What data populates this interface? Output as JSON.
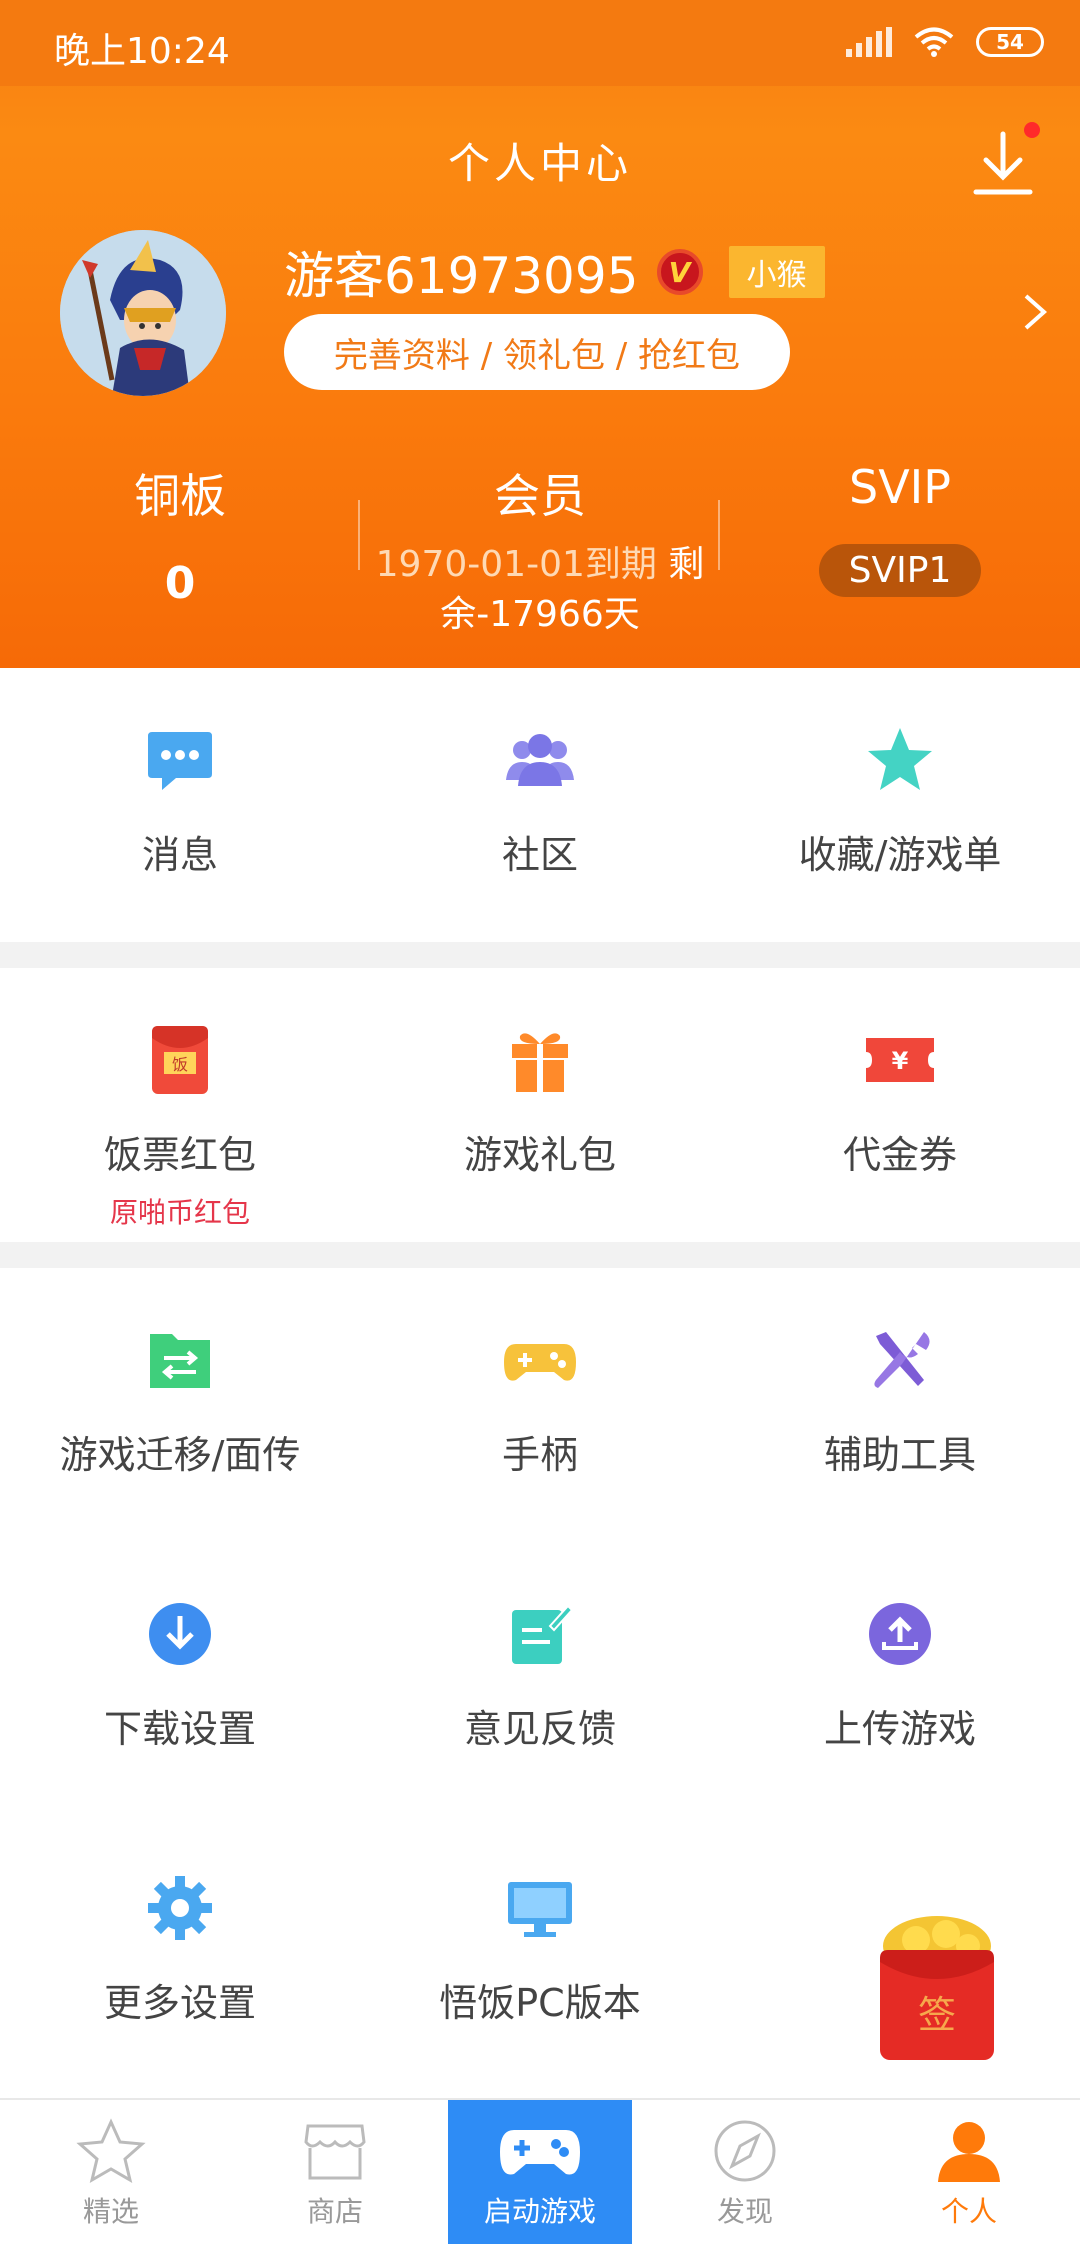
{
  "status_bar": {
    "time": "晚上10:24",
    "battery": "54"
  },
  "header": {
    "title": "个人中心",
    "username": "游客61973095",
    "vip_mark": "V",
    "level_badge": "小猴",
    "profile_button": "完善资料 / 领礼包 / 抢红包"
  },
  "stats": {
    "copper": {
      "label": "铜板",
      "value": "0"
    },
    "member": {
      "label": "会员",
      "date": "1970-01-01到期",
      "rest": "剩余-17966天",
      "rest_a": "剩",
      "rest_b": "余-17966天"
    },
    "svip": {
      "label": "SVIP",
      "level": "SVIP1"
    }
  },
  "grid1": [
    {
      "label": "消息",
      "icon": "message-icon"
    },
    {
      "label": "社区",
      "icon": "community-icon"
    },
    {
      "label": "收藏/游戏单",
      "icon": "star-icon"
    }
  ],
  "grid2": [
    {
      "label": "饭票红包",
      "sub": "原啪币红包",
      "icon": "red-envelope-icon",
      "icon_text": "饭"
    },
    {
      "label": "游戏礼包",
      "icon": "gift-icon"
    },
    {
      "label": "代金券",
      "icon": "coupon-icon",
      "icon_text": "¥"
    }
  ],
  "grid3": [
    {
      "label": "游戏迁移/面传",
      "icon": "transfer-folder-icon"
    },
    {
      "label": "手柄",
      "icon": "gamepad-icon"
    },
    {
      "label": "辅助工具",
      "icon": "tools-icon"
    },
    {
      "label": "下载设置",
      "icon": "download-circle-icon"
    },
    {
      "label": "意见反馈",
      "icon": "feedback-icon"
    },
    {
      "label": "上传游戏",
      "icon": "upload-circle-icon"
    },
    {
      "label": "更多设置",
      "icon": "gear-icon"
    },
    {
      "label": "悟饭PC版本",
      "icon": "monitor-icon"
    }
  ],
  "float_packet": {
    "text": "签"
  },
  "bottom_nav": [
    {
      "label": "精选",
      "icon": "star-outline-icon"
    },
    {
      "label": "商店",
      "icon": "store-icon"
    },
    {
      "label": "启动游戏",
      "icon": "gamepad-launch-icon"
    },
    {
      "label": "发现",
      "icon": "compass-icon"
    },
    {
      "label": "个人",
      "icon": "person-icon"
    }
  ],
  "colors": {
    "accent": "#f67d11",
    "launch_blue": "#2e8cf5",
    "active_orange": "#ff7a0a"
  }
}
